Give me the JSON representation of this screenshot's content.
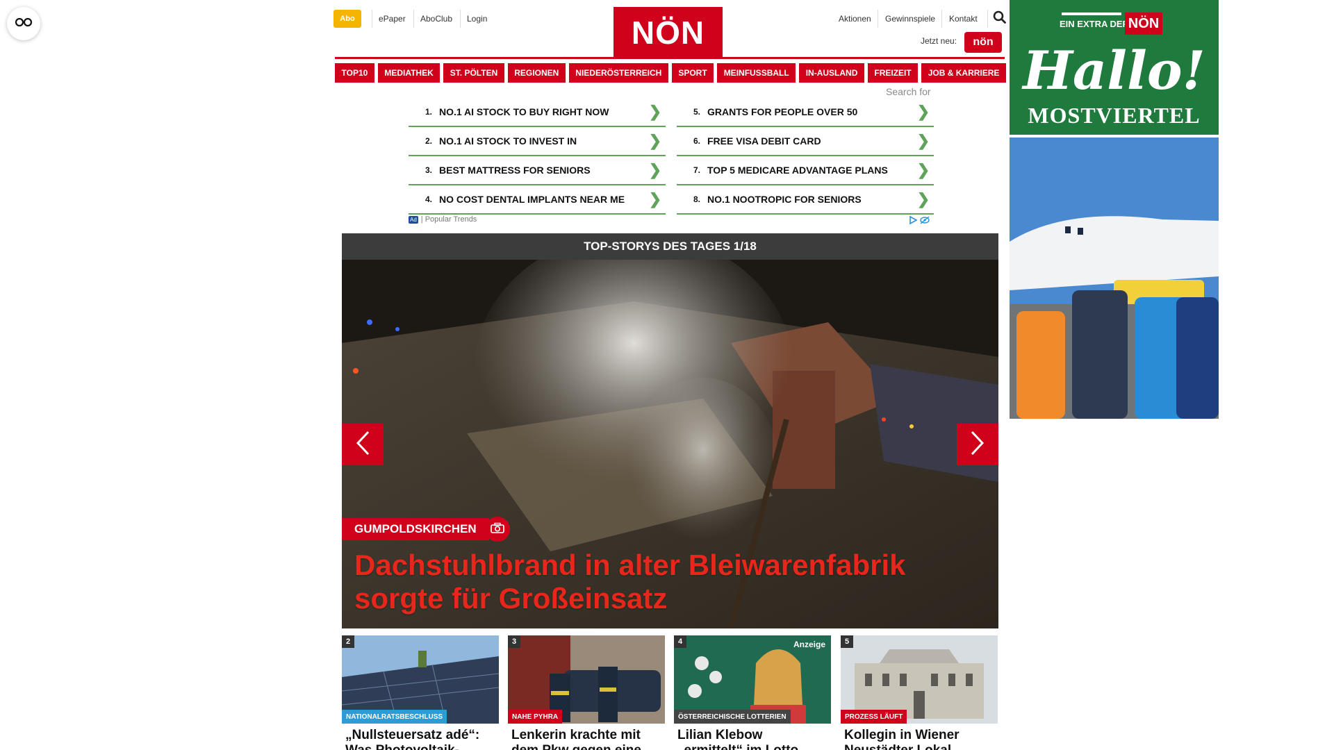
{
  "reader_widget": {
    "icon": "glasses-icon"
  },
  "header": {
    "abo_label": "Abo",
    "left_links": [
      "ePaper",
      "AboClub",
      "Login"
    ],
    "logo_text": "NÖN",
    "right_links": [
      "Aktionen",
      "Gewinnspiele",
      "Kontakt"
    ],
    "search_icon": "search-icon",
    "jetzt_neu_label": "Jetzt neu:",
    "jetzt_badge_text": "nön"
  },
  "nav": {
    "items": [
      "TOP10",
      "MEDIATHEK",
      "ST. PÖLTEN",
      "REGIONEN",
      "NIEDERÖSTERREICH",
      "SPORT",
      "MEINFUSSBALL",
      "IN-AUSLAND",
      "FREIZEIT",
      "JOB & KARRIERE"
    ]
  },
  "search_for_label": "Search for",
  "ad_list": {
    "left": [
      {
        "num": "1.",
        "text": "NO.1 AI STOCK TO BUY RIGHT NOW"
      },
      {
        "num": "2.",
        "text": "NO.1 AI STOCK TO INVEST IN"
      },
      {
        "num": "3.",
        "text": "BEST MATTRESS FOR SENIORS"
      },
      {
        "num": "4.",
        "text": "NO COST DENTAL IMPLANTS NEAR ME"
      }
    ],
    "right": [
      {
        "num": "5.",
        "text": "GRANTS FOR PEOPLE OVER 50"
      },
      {
        "num": "6.",
        "text": "FREE VISA DEBIT CARD"
      },
      {
        "num": "7.",
        "text": "TOP 5 MEDICARE ADVANTAGE PLANS"
      },
      {
        "num": "8.",
        "text": "NO.1 NOOTROPIC FOR SENIORS"
      }
    ],
    "chevron": "❯",
    "ad_badge": "Ad",
    "footer_text": "| Popular Trends"
  },
  "top_stories": {
    "header": "TOP-STORYS DES TAGES 1/18",
    "hero": {
      "category": "GUMPOLDSKIRCHEN",
      "title": "Dachstuhlbrand in alter Bleiwarenfabrik sorgte für Großeinsatz",
      "camera_icon": "camera-icon"
    },
    "cards": [
      {
        "num": "2",
        "category": "NATIONALRATSBESCHLUSS",
        "category_color": "#2e9bd6",
        "title": "„Nullsteuersatz adé“: Was Photovoltaik-"
      },
      {
        "num": "3",
        "category": "NAHE PYHRA",
        "category_color": "#d0021b",
        "title": "Lenkerin krachte mit dem Pkw gegen eine"
      },
      {
        "num": "4",
        "category": "ÖSTERREICHISCHE LOTTERIEN",
        "category_color": "#444444",
        "title": "Lilian Klebow „ermittelt“ im Lotto Studio",
        "anzeige": "Anzeige"
      },
      {
        "num": "5",
        "category": "PROZESS LÄUFT",
        "category_color": "#d0021b",
        "title": "Kollegin in Wiener Neustädter Lokal sexuell"
      }
    ]
  },
  "right_ad": {
    "extra_label": "EIN EXTRA DER",
    "logo_text": "NÖN",
    "headline": "Hallo!",
    "subline": "MOSTVIERTEL"
  },
  "colors": {
    "brand_red": "#d0021b",
    "abo_yellow": "#f5b400",
    "ad_green": "#1f7a3e",
    "chevron_green": "#5fa35a"
  }
}
